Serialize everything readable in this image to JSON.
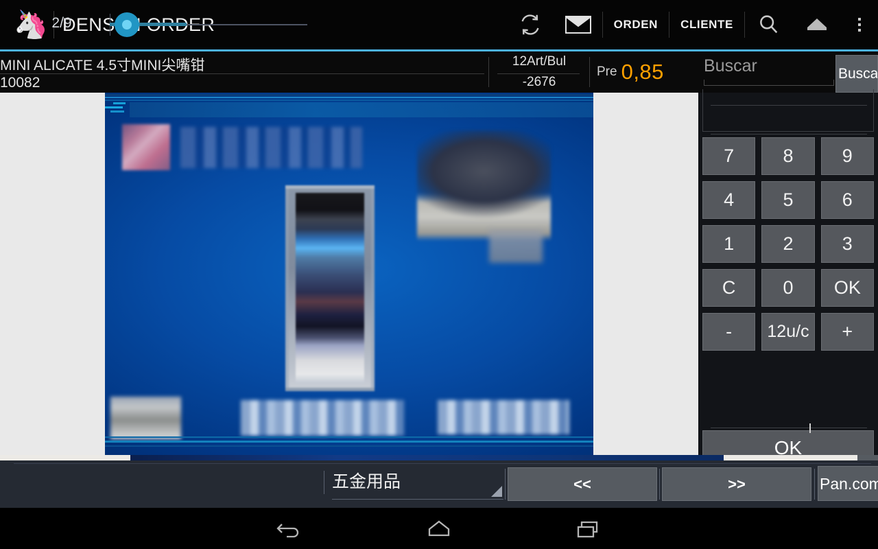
{
  "app": {
    "title": "DENSEN ORDER",
    "logo_icon": "unicorn-logo"
  },
  "actionbar": {
    "items": [
      {
        "name": "refresh-icon",
        "label": "",
        "type": "icon"
      },
      {
        "name": "mail-icon",
        "label": "",
        "type": "icon"
      },
      {
        "name": "orden-button",
        "label": "ORDEN",
        "type": "text"
      },
      {
        "name": "cliente-button",
        "label": "CLIENTE",
        "type": "text"
      },
      {
        "name": "search-icon",
        "label": "",
        "type": "icon"
      },
      {
        "name": "home-icon",
        "label": "",
        "type": "icon"
      },
      {
        "name": "overflow-menu-icon",
        "label": "",
        "type": "icon"
      }
    ],
    "accent_color": "#4cb3e6"
  },
  "product": {
    "name": "MINI ALICATE 4.5寸MINI尖嘴钳",
    "code": "10082",
    "bulk_top": "12Art/Bul",
    "bulk_bottom": "-2676",
    "price_label": "Pre",
    "price_value": "0,85",
    "price_color": "#ffa000"
  },
  "search": {
    "value": "",
    "placeholder": "Buscar",
    "button_label": "Buscar"
  },
  "keypad": {
    "rows": [
      [
        "7",
        "8",
        "9"
      ],
      [
        "4",
        "5",
        "6"
      ],
      [
        "1",
        "2",
        "3"
      ],
      [
        "C",
        "0",
        "OK"
      ],
      [
        "-",
        "12u/c",
        "+"
      ]
    ],
    "ok_label": "OK",
    "quantity_value": ""
  },
  "bottom": {
    "page_indicator": "2/9",
    "slider_value": 12,
    "category": "五金用品",
    "prev_label": "<<",
    "next_label": ">>",
    "pan_label": "Pan.com"
  },
  "navbar": {
    "back": "back-icon",
    "home": "home-icon",
    "recent": "recent-apps-icon"
  },
  "colors": {
    "accent": "#4cb3e6",
    "price": "#ffa000",
    "bottombar": "#252a33",
    "key": "#55585d",
    "content_bg": "#e9e9e9"
  }
}
